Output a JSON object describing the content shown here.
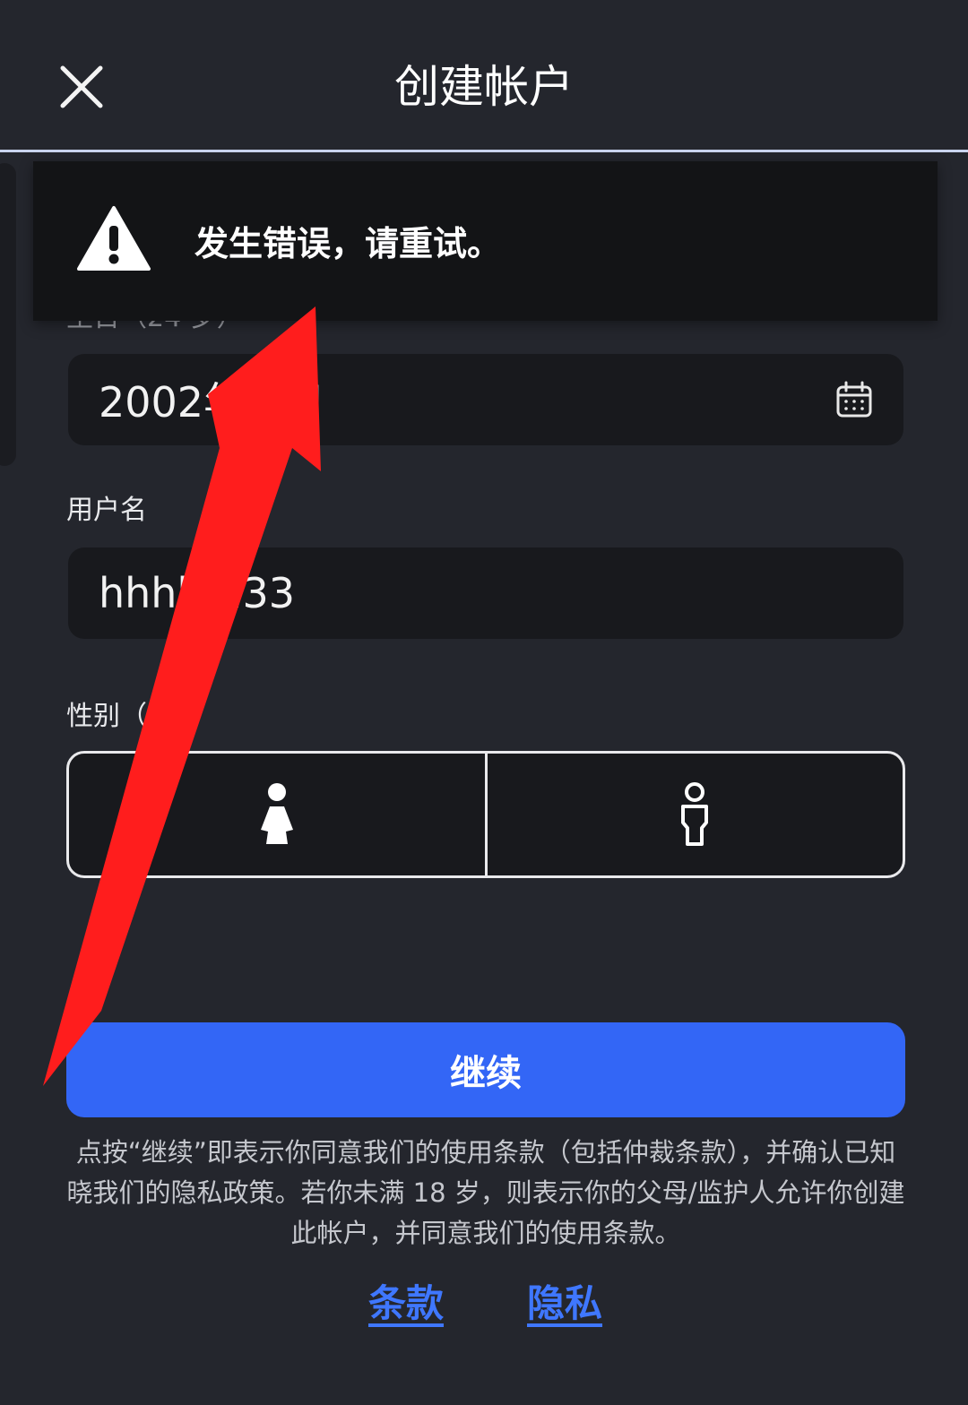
{
  "header": {
    "title": "创建帐户"
  },
  "toast": {
    "message": "发生错误，请重试。"
  },
  "form": {
    "birthday_label": "生日（24 岁）",
    "birthday_value": "2002年 1日",
    "username_label": "用户名",
    "username_value": "hhhh 233",
    "gender_label": "性别（ 选）",
    "gender_options": [
      "female-icon",
      "male-icon"
    ]
  },
  "actions": {
    "continue_label": "继续"
  },
  "legal": {
    "notice": "点按“继续”即表示你同意我们的使用条款（包括仲裁条款），并确认已知晓我们的隐私政策。若你未满 18 岁，则表示你的父母/监护人允许你创建此帐户，并同意我们的使用条款。",
    "terms_link": "条款",
    "privacy_link": "隐私"
  },
  "colors": {
    "background": "#24262d",
    "input_background": "#18191d",
    "primary_button": "#3366f6",
    "link": "#3f77ff",
    "annotation_arrow": "#ff1d1d"
  }
}
